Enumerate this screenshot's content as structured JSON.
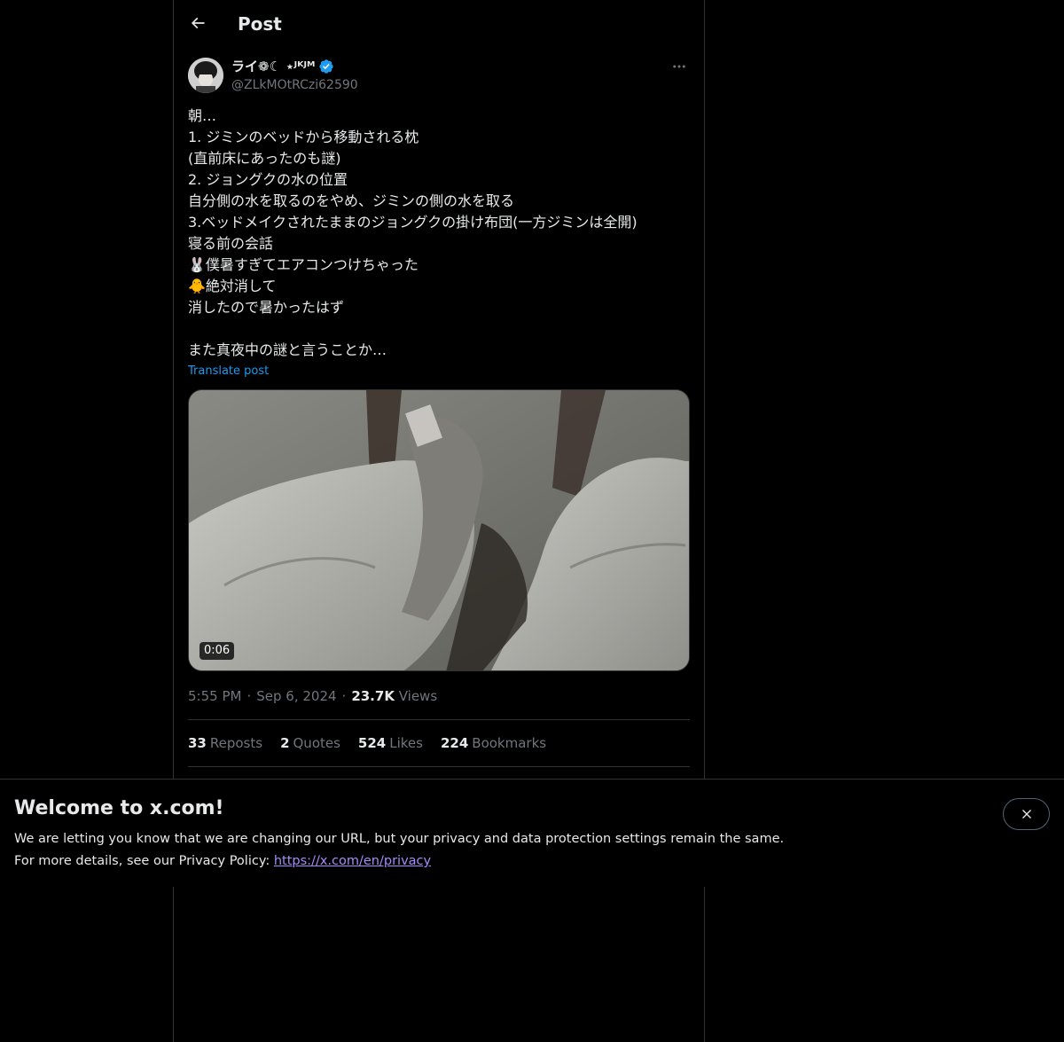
{
  "header": {
    "title": "Post"
  },
  "post": {
    "author": {
      "display_name": "ライ❁☾ ⋆ᴶᴷᴶᴹ",
      "handle": "@ZLkMOtRCzi62590",
      "verified": true
    },
    "text_lines": [
      "朝…",
      "1. ジミンのベッドから移動される枕",
      "(直前床にあったのも謎)",
      "2. ジョングクの水の位置",
      "自分側の水を取るのをやめ、ジミンの側の水を取る",
      "3.ベッドメイクされたままのジョングクの掛け布団(一方ジミンは全開)",
      "寝る前の会話",
      "🐰僕暑すぎてエアコンつけちゃった",
      "🐥絶対消して",
      "消したので暑かったはず",
      "",
      "また真夜中の謎と言うことか…"
    ],
    "translate_label": "Translate post",
    "video_duration": "0:06",
    "time": "5:55 PM",
    "date": "Sep 6, 2024",
    "views_count": "23.7K",
    "views_label": "Views",
    "stats": {
      "reposts": {
        "count": "33",
        "label": "Reposts"
      },
      "quotes": {
        "count": "2",
        "label": "Quotes"
      },
      "likes": {
        "count": "524",
        "label": "Likes"
      },
      "bookmarks": {
        "count": "224",
        "label": "Bookmarks"
      }
    }
  },
  "banner": {
    "title": "Welcome to x.com!",
    "line1": "We are letting you know that we are changing our URL, but your privacy and data protection settings remain the same.",
    "line2_prefix": "For more details, see our Privacy Policy: ",
    "link_text": "https://x.com/en/privacy"
  },
  "colors": {
    "background": "#000000",
    "text": "#e7e9ea",
    "muted": "#71767b",
    "accent": "#1d9bf0",
    "border": "#2f3336"
  }
}
